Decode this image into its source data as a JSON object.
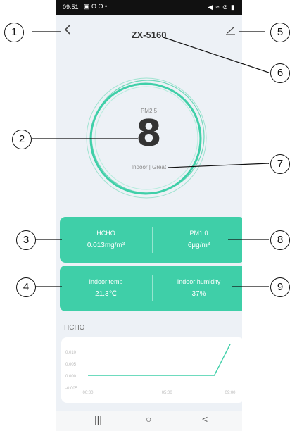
{
  "status_bar": {
    "time": "09:51",
    "left_icons": "▣ O O •",
    "right_icons": "◀ ≈ ⊘ ▮"
  },
  "header": {
    "title": "ZX-5160"
  },
  "pm25": {
    "label": "PM2.5",
    "value": "8",
    "status": "Indoor | Great"
  },
  "cards": [
    {
      "left_label": "HCHO",
      "left_value": "0.013mg/m³",
      "right_label": "PM1.0",
      "right_value": "6μg/m³"
    },
    {
      "left_label": "Indoor temp",
      "left_value": "21.3℃",
      "right_label": "Indoor humidity",
      "right_value": "37%"
    }
  ],
  "section_title": "HCHO",
  "chart_data": {
    "type": "line",
    "x_ticks": [
      "00:00",
      "05:00",
      "09:00"
    ],
    "y_ticks": [
      "0.010",
      "0.005",
      "0.000",
      "-0.005"
    ],
    "ylim": [
      -0.005,
      0.01
    ],
    "series": [
      {
        "x": [
          "00:00",
          "05:00",
          "08:00",
          "09:00"
        ],
        "values": [
          0.0,
          0.0,
          0.0,
          0.013
        ]
      }
    ],
    "color": "#3fcfa8"
  },
  "callouts": [
    "1",
    "2",
    "3",
    "4",
    "5",
    "6",
    "7",
    "8",
    "9"
  ],
  "colors": {
    "accent": "#3fcfa8",
    "background": "#edf1f6"
  },
  "nav": {
    "recent": "|||",
    "home": "○",
    "back": "<"
  }
}
